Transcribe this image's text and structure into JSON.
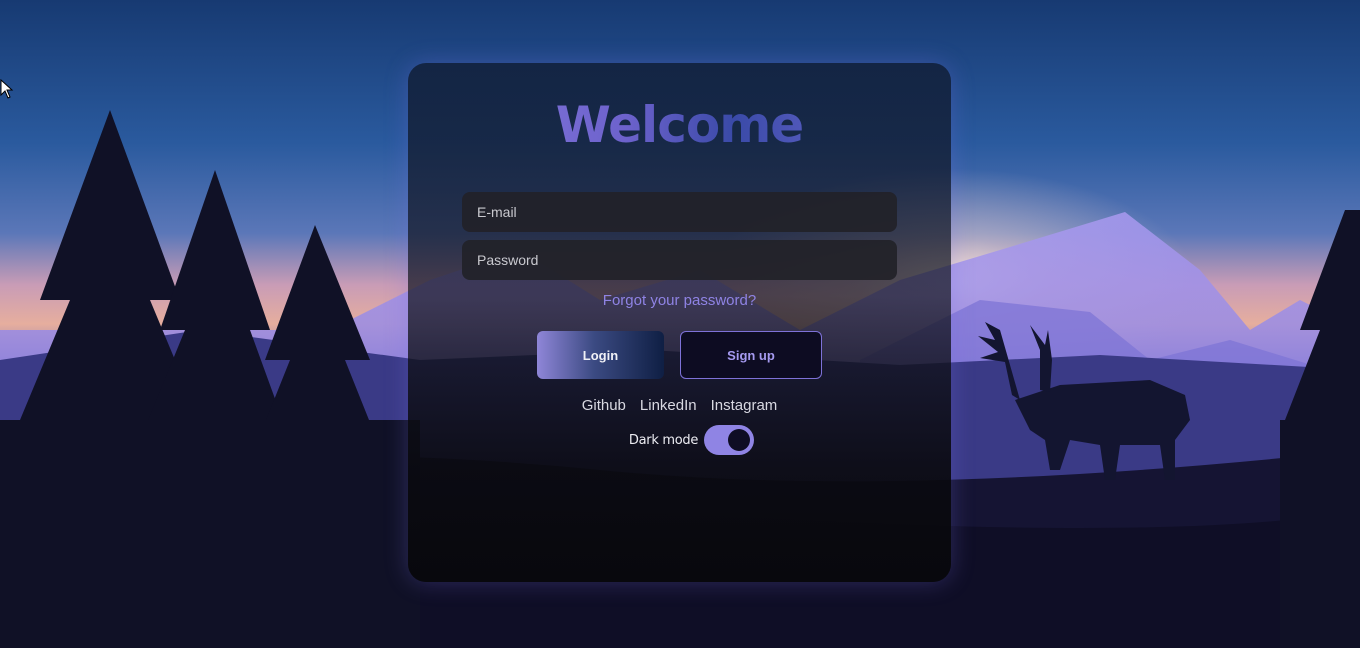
{
  "form": {
    "title": "Welcome",
    "email_placeholder": "E-mail",
    "password_placeholder": "Password",
    "forgot_label": "Forgot your password?",
    "login_label": "Login",
    "signup_label": "Sign up"
  },
  "socials": {
    "github": "Github",
    "linkedin": "LinkedIn",
    "instagram": "Instagram"
  },
  "theme": {
    "dark_mode_label": "Dark mode",
    "dark_mode_on": true,
    "accent": "#8f84e4",
    "button_dark": "#0d0c22"
  },
  "icons": [
    "cursor-icon"
  ]
}
